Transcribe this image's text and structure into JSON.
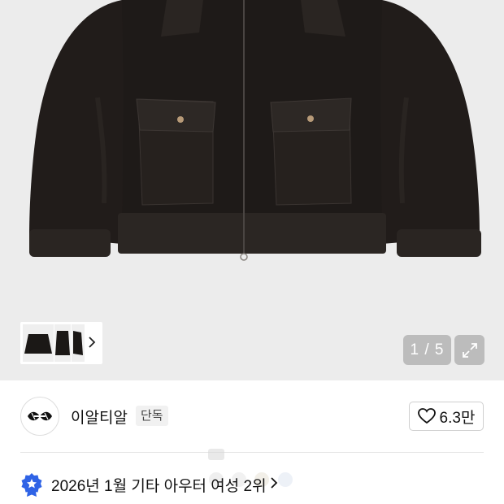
{
  "gallery": {
    "pager_text": "1 / 5",
    "current_page": 1,
    "total_pages": 5,
    "expand_icon": "expand-icon",
    "thumb_chevron_icon": "chevron-right-icon"
  },
  "store": {
    "name": "이알티알",
    "badge": "단독",
    "like_count": "6.3만",
    "like_icon": "heart-outline-icon"
  },
  "ranking": {
    "text": "2026년 1월 기타 아우터 여성 2위",
    "icon": "medal-icon",
    "medal_color": "#2f63e6"
  },
  "colors": {
    "hero_background": "#ececec",
    "divider": "#e5e5e5"
  }
}
